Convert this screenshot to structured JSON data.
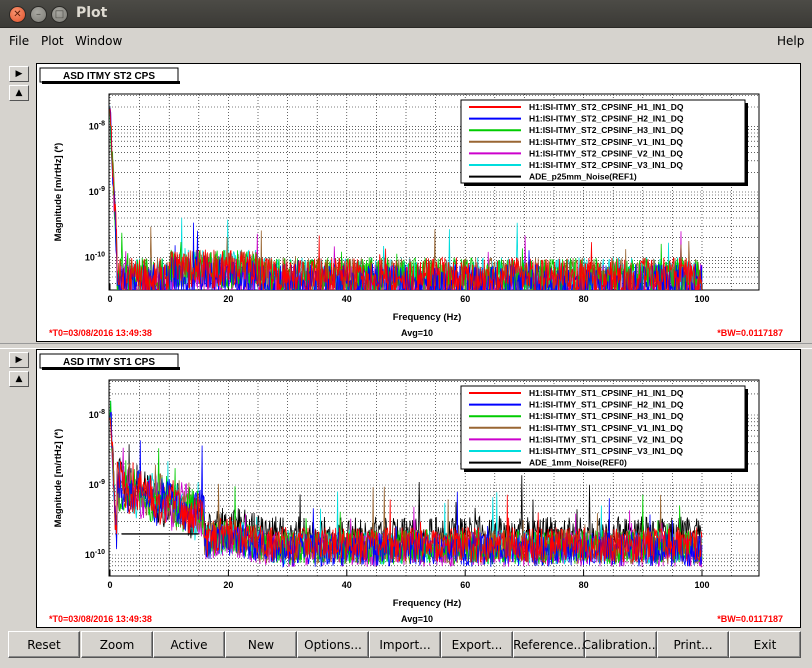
{
  "window": {
    "title": "Plot"
  },
  "menubar": {
    "file": "File",
    "plot": "Plot",
    "window": "Window",
    "help": "Help"
  },
  "buttons": {
    "reset": "Reset",
    "zoom": "Zoom",
    "active": "Active",
    "new": "New",
    "options": "Options...",
    "import": "Import...",
    "export": "Export...",
    "reference": "Reference...",
    "calibration": "Calibration...",
    "print": "Print...",
    "exit": "Exit"
  },
  "chart_data": [
    {
      "type": "line",
      "title": "ASD ITMY ST2 CPS",
      "xlabel": "Frequency (Hz)",
      "ylabel": "Magnitude [m/rtHz] (*)",
      "xlim": [
        0,
        100
      ],
      "ylim_log10": [
        -10.5,
        -7.5
      ],
      "log_y": true,
      "x_ticks": [
        "0",
        "20",
        "40",
        "60",
        "80",
        "100"
      ],
      "y_ticks": [
        "10-8",
        "10-9",
        "10-10"
      ],
      "grid": true,
      "legend_position": "top-right",
      "footer": {
        "t0": "*T0=03/08/2016 13:49:38",
        "avg": "Avg=10",
        "bw": "*BW=0.0117187"
      },
      "series": [
        {
          "name": "H1:ISI-ITMY_ST2_CPSINF_H1_IN1_DQ",
          "color": "#ff0000",
          "floor": 5e-11
        },
        {
          "name": "H1:ISI-ITMY_ST2_CPSINF_H2_IN1_DQ",
          "color": "#0000ff",
          "floor": 4e-11
        },
        {
          "name": "H1:ISI-ITMY_ST2_CPSINF_H3_IN1_DQ",
          "color": "#00cc00",
          "floor": 5e-11
        },
        {
          "name": "H1:ISI-ITMY_ST2_CPSINF_V1_IN1_DQ",
          "color": "#996633",
          "floor": 5e-11
        },
        {
          "name": "H1:ISI-ITMY_ST2_CPSINF_V2_IN1_DQ",
          "color": "#cc00cc",
          "floor": 4e-11
        },
        {
          "name": "H1:ISI-ITMY_ST2_CPSINF_V3_IN1_DQ",
          "color": "#00dddd",
          "floor": 5e-11
        },
        {
          "name": "ADE_p25mm_Noise(REF1)",
          "color": "#000000",
          "floor": null
        }
      ]
    },
    {
      "type": "line",
      "title": "ASD ITMY ST1 CPS",
      "xlabel": "Frequency (Hz)",
      "ylabel": "Magnitude [m/rtHz] (*)",
      "xlim": [
        0,
        100
      ],
      "ylim_log10": [
        -10.3,
        -7.5
      ],
      "log_y": true,
      "x_ticks": [
        "0",
        "20",
        "40",
        "60",
        "80",
        "100"
      ],
      "y_ticks": [
        "10-8",
        "10-9",
        "10-10"
      ],
      "grid": true,
      "legend_position": "top-right",
      "footer": {
        "t0": "*T0=03/08/2016 13:49:38",
        "avg": "Avg=10",
        "bw": "*BW=0.0117187"
      },
      "series": [
        {
          "name": "H1:ISI-ITMY_ST1_CPSINF_H1_IN1_DQ",
          "color": "#ff0000",
          "floor": 1.4e-10
        },
        {
          "name": "H1:ISI-ITMY_ST1_CPSINF_H2_IN1_DQ",
          "color": "#0000ff",
          "floor": 1.2e-10
        },
        {
          "name": "H1:ISI-ITMY_ST1_CPSINF_H3_IN1_DQ",
          "color": "#00cc00",
          "floor": 1.3e-10
        },
        {
          "name": "H1:ISI-ITMY_ST1_CPSINF_V1_IN1_DQ",
          "color": "#996633",
          "floor": 1.3e-10
        },
        {
          "name": "H1:ISI-ITMY_ST1_CPSINF_V2_IN1_DQ",
          "color": "#cc00cc",
          "floor": 1.2e-10
        },
        {
          "name": "H1:ISI-ITMY_ST1_CPSINF_V3_IN1_DQ",
          "color": "#00dddd",
          "floor": 1.3e-10
        },
        {
          "name": "ADE_1mm_Noise(REF0)",
          "color": "#000000",
          "floor": 2e-10
        }
      ]
    }
  ]
}
